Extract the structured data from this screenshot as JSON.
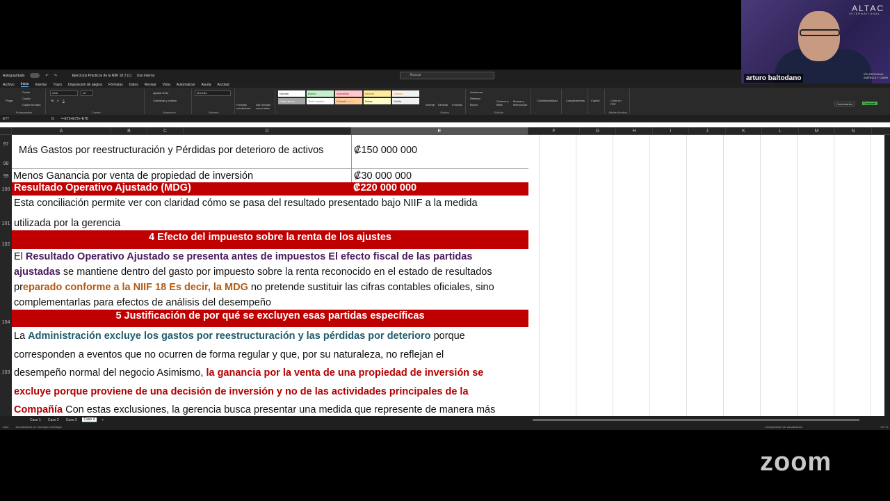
{
  "window": {
    "autosave": "Autoguardado",
    "filename": "Ejercicios Prácticos de la NIIF 18 2 (1)",
    "sensitivity": "Uso interno",
    "search_placeholder": "Buscar"
  },
  "menu": [
    "Archivo",
    "Inicio",
    "Insertar",
    "Trazo",
    "Disposición de página",
    "Fórmulas",
    "Datos",
    "Revisar",
    "Vista",
    "Automatizar",
    "Ayuda",
    "Acrobat"
  ],
  "ribbon": {
    "paste": "Pegar",
    "cut": "Cortar",
    "copy": "Copiar",
    "format_painter": "Copiar formato",
    "clipboard": "Portapapeles",
    "font_name": "Arial",
    "font_size": "18",
    "font_group": "Fuente",
    "wrap": "Ajustar texto",
    "merge": "Combinar y centrar",
    "alignment": "Alineación",
    "num_format": "Moneda",
    "number": "Número",
    "cond_format": "Formato condicional",
    "table_format": "Dar formato como tabla",
    "styles_group": "Estilos",
    "styles": [
      "Normal",
      "Bueno",
      "Incorrecto",
      "Neutral",
      "Cálculo",
      "Celda de co...",
      "Texto explica...",
      "Entrada",
      "Notas",
      "Salida"
    ],
    "insert": "Insertar",
    "delete": "Eliminar",
    "format": "Formato",
    "cells": "Celdas",
    "autosum": "Autosuma",
    "fill": "Rellenar",
    "clear": "Borrar",
    "sort": "Ordenar y filtrar",
    "find": "Buscar y seleccionar",
    "editing": "Edición",
    "confid": "Confidencialidad",
    "addins": "Complementos",
    "copilot": "Copilot",
    "pdf": "Crear un PDF",
    "acrobat": "Adobe Acrobat",
    "comments": "Comentarios",
    "share": "Compartir"
  },
  "formula": {
    "cell": "E77",
    "fx": "fx",
    "value": "=-E73+E75+-E76"
  },
  "columns": [
    "A",
    "B",
    "C",
    "D",
    "E",
    "F",
    "G",
    "H",
    "I",
    "J",
    "K",
    "L",
    "M",
    "N"
  ],
  "rows": [
    "97",
    "98",
    "99",
    "100",
    "101",
    "102",
    "103",
    "104"
  ],
  "cells": {
    "r97_text": "Más Gastos por reestructuración  y   Pérdidas por deterioro de activos",
    "r97_val": "₡150 000 000",
    "r99_text": "Menos Ganancia por venta de propiedad de inversión",
    "r99_val": "₡30 000 000",
    "r100_text": "Resultado Operativo Ajustado (MDG)",
    "r100_val": "₡220 000 000",
    "r101_l1": "Esta conciliación permite ver con claridad cómo se pasa del resultado presentado bajo NIIF a la medida",
    "r101_l2": "utilizada por la gerencia",
    "r102": "4 Efecto del impuesto sobre la renta de los ajustes",
    "r103_a": "El ",
    "r103_b": "Resultado Operativo Ajustado se presenta antes de impuestos El efecto fiscal de las partidas",
    "r103_c": "ajustadas",
    "r103_d": " se mantiene dentro del gasto por impuesto sobre la renta reconocido en el estado de resultados",
    "r103_e": "pr",
    "r103_f": "eparado conforme a la NIIF 18 Es decir, la MDG",
    "r103_g": " no pretende sustituir las cifras contables oficiales, sino",
    "r103_h": "complementarlas para efectos de análisis del desempeño",
    "r104": "5 Justificación de por qué se excluyen esas partidas específicas",
    "r105_a": "La ",
    "r105_b": "Administración excluye los gastos por reestructuración y las pérdidas por deterioro",
    "r105_c": " porque",
    "r105_d": "corresponden a eventos que no ocurren de forma regular y que, por su naturaleza, no reflejan el",
    "r105_e": "desempeño normal del negocio Asimismo, ",
    "r105_f": "la ganancia por la venta de una propiedad de inversión se",
    "r105_g": "excluye porque proviene de una decisión de inversión y no de las actividades principales de la",
    "r105_h": "Compañía",
    "r105_i": " Con estas exclusiones, la gerencia busca presentar una medida que represente de manera más"
  },
  "sheets": [
    "Caso 1",
    "Caso 2",
    "Caso 3",
    "Caso 4"
  ],
  "status": {
    "mode": "Listo",
    "access": "Accesibilidad: es necesario investigar",
    "display": "Configuración de visualización",
    "zoom": "170 %"
  },
  "video": {
    "participant": "arturo baltodano",
    "logo": "ALTAC",
    "logo_sub": "INTERNATIONAL",
    "region": "IÓN REGIONAL AMÉRICA Y CARIB"
  },
  "zoom_logo": "zoom",
  "colors": {
    "red_bar": "#c00000",
    "purple": "#4b1a5e",
    "orange": "#b35a12",
    "teal": "#1f5c6e"
  }
}
